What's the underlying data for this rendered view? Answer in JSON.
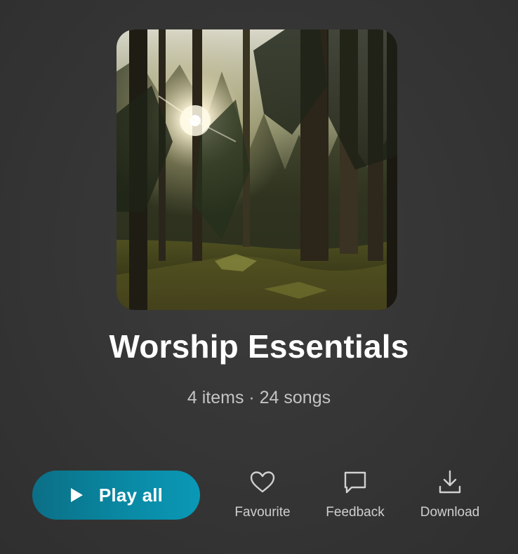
{
  "playlist": {
    "title": "Worship Essentials",
    "meta": "4 items · 24 songs",
    "cover_image": "forest-sunlight-cover"
  },
  "actions": {
    "play_all": {
      "label": "Play all",
      "icon": "play-icon"
    },
    "favourite": {
      "label": "Favourite",
      "icon": "heart-icon"
    },
    "feedback": {
      "label": "Feedback",
      "icon": "chat-bubble-icon"
    },
    "download": {
      "label": "Download",
      "icon": "download-icon"
    }
  },
  "colors": {
    "background": "#363636",
    "accent": "#0a8ba6",
    "text_primary": "#ffffff",
    "text_secondary": "#c4c4c4"
  }
}
